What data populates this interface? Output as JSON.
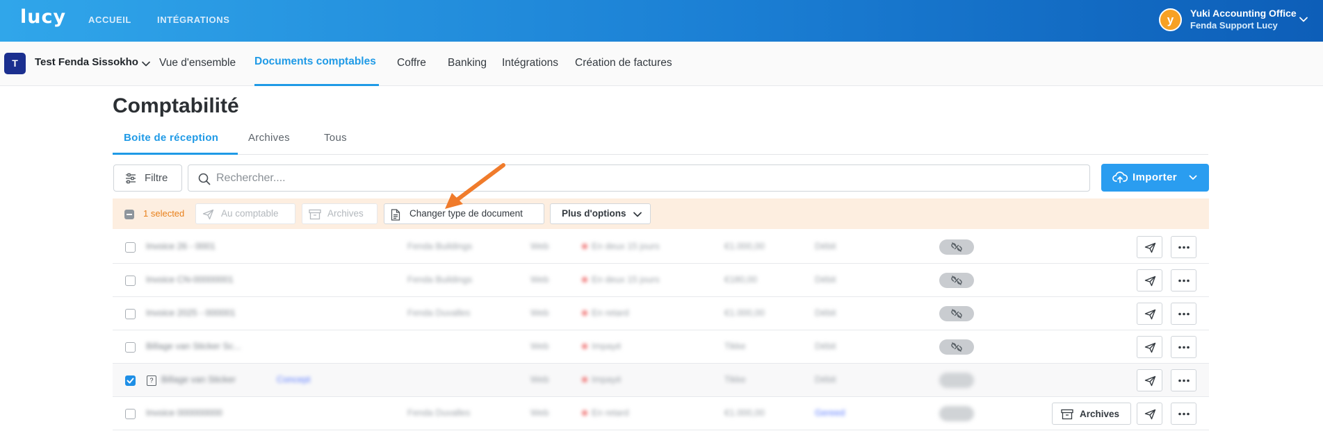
{
  "topbar": {
    "logo": "lucy",
    "nav": [
      "ACCUEIL",
      "INTÉGRATIONS"
    ],
    "org_initial": "y",
    "org_name": "Yuki Accounting Office",
    "org_sub": "Fenda Support Lucy"
  },
  "subnav": {
    "client_initial": "T",
    "client_name": "Test Fenda Sissokho",
    "links": [
      "Vue d'ensemble",
      "Documents comptables",
      "Coffre",
      "Banking",
      "Intégrations",
      "Création de factures"
    ],
    "active": "Documents comptables"
  },
  "page": {
    "title": "Comptabilité",
    "tabs": [
      "Boite de réception",
      "Archives",
      "Tous"
    ],
    "active_tab": "Boite de réception"
  },
  "toolbar": {
    "filter_label": "Filtre",
    "search_placeholder": "Rechercher....",
    "import_label": "Importer"
  },
  "selection": {
    "count_label": "1 selected",
    "to_accountant": "Au comptable",
    "archive": "Archives",
    "change_type": "Changer type de document",
    "more_options": "Plus d'options"
  },
  "rows": [
    {
      "name": "Invoice 26 - 0001",
      "supplier": "Fenda Buildings",
      "type": "Web",
      "status": "En deux 15 jours",
      "amount": "€1.000,00",
      "state": "Débit",
      "checked": false
    },
    {
      "name": "Invoice CN-00000001",
      "supplier": "Fenda Buildings",
      "type": "Web",
      "status": "En deux 15 jours",
      "amount": "€180,00",
      "state": "Débit",
      "checked": false
    },
    {
      "name": "Invoice 2025 - 000001",
      "supplier": "Fenda Duvalles",
      "type": "Web",
      "status": "En retard",
      "amount": "€1.000,00",
      "state": "Débit",
      "checked": false
    },
    {
      "name": "Billage van Sticker Sc...",
      "supplier": "",
      "type": "Web",
      "status": "Impayé",
      "amount": "Tikke",
      "state": "Débit",
      "checked": false
    },
    {
      "name": "Billage van Sticker",
      "supplier": "",
      "tag": "Concept",
      "type": "Web",
      "status": "Impayé",
      "amount": "Tikke",
      "state": "Débit",
      "checked": true
    },
    {
      "name": "Invoice 000000000",
      "supplier": "Fenda Duvalles",
      "type": "Web",
      "status": "En retard",
      "amount": "€1.000,00",
      "state": "Gereed",
      "checked": false,
      "row_archive": "Archives"
    }
  ],
  "colors": {
    "accent": "#1f9ae6",
    "topbar_start": "#30a6ea",
    "topbar_end": "#0d5eb8",
    "selection_bar": "#fdeee0",
    "selection_text": "#e8801b",
    "annotation_arrow": "#f07b2b"
  }
}
